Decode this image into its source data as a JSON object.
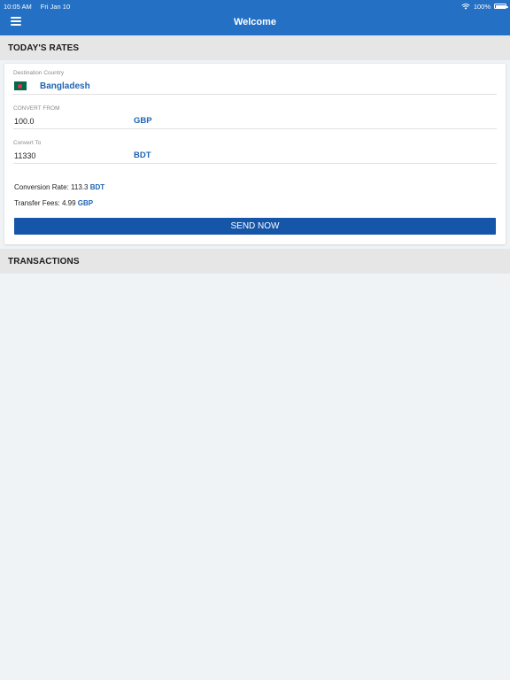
{
  "status_bar": {
    "time": "10:05 AM",
    "date": "Fri Jan 10",
    "battery": "100%"
  },
  "header": {
    "title": "Welcome"
  },
  "sections": {
    "rates": "TODAY'S RATES",
    "transactions": "TRANSACTIONS"
  },
  "rates": {
    "destination_label": "Destination Country",
    "destination_value": "Bangladesh",
    "from_label": "CONVERT FROM",
    "from_amount": "100.0",
    "from_currency": "GBP",
    "to_label": "Convert To",
    "to_amount": "11330",
    "to_currency": "BDT",
    "rate_label": "Conversion Rate: ",
    "rate_value": "113.3",
    "rate_currency": "BDT",
    "fees_label": "Transfer Fees: ",
    "fees_value": "4.99",
    "fees_currency": "GBP",
    "send_label": "SEND NOW"
  },
  "colors": {
    "brand": "#2370c4",
    "button": "#1656a8",
    "accent_text": "#1d63b3"
  },
  "icons": {
    "menu": "hamburger-icon",
    "wifi": "wifi-icon",
    "battery": "battery-icon",
    "flag": "bangladesh-flag-icon"
  }
}
